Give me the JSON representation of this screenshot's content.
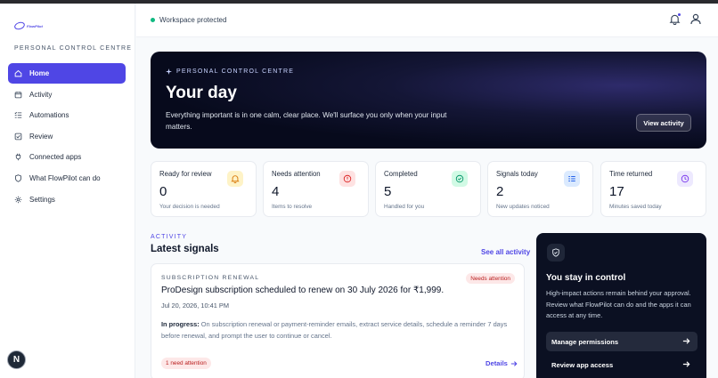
{
  "brand": {
    "logo_text": "FlowPilot",
    "accent": "#4f46e5"
  },
  "sidebar": {
    "heading": "PERSONAL CONTROL CENTRE",
    "items": [
      {
        "label": "Home",
        "icon": "home-icon",
        "active": true
      },
      {
        "label": "Activity",
        "icon": "calendar-icon"
      },
      {
        "label": "Automations",
        "icon": "list-check-icon"
      },
      {
        "label": "Review",
        "icon": "check-square-icon"
      },
      {
        "label": "Connected apps",
        "icon": "plug-icon"
      },
      {
        "label": "What FlowPilot can do",
        "icon": "shield-icon"
      },
      {
        "label": "Settings",
        "icon": "gear-icon"
      }
    ],
    "avatar_letter": "N"
  },
  "header": {
    "status_text": "Workspace protected",
    "status_color": "#10b981"
  },
  "hero": {
    "kicker": "PERSONAL CONTROL CENTRE",
    "title": "Your day",
    "description": "Everything important is in one calm, clear place. We'll surface you only when your input matters.",
    "button_label": "View activity"
  },
  "stats": [
    {
      "label": "Ready for review",
      "value": "0",
      "sub": "Your decision is needed",
      "icon": "bell-icon",
      "color": "#d97706",
      "bg": "#fef3c7"
    },
    {
      "label": "Needs attention",
      "value": "4",
      "sub": "Items to resolve",
      "icon": "alert-circle-icon",
      "color": "#dc2626",
      "bg": "#fee2e2"
    },
    {
      "label": "Completed",
      "value": "5",
      "sub": "Handled for you",
      "icon": "check-circle-icon",
      "color": "#059669",
      "bg": "#d1fae5"
    },
    {
      "label": "Signals today",
      "value": "2",
      "sub": "New updates noticed",
      "icon": "list-icon",
      "color": "#2563eb",
      "bg": "#dbeafe"
    },
    {
      "label": "Time returned",
      "value": "17",
      "sub": "Minutes saved today",
      "icon": "clock-icon",
      "color": "#7c3aed",
      "bg": "#ede9fe"
    }
  ],
  "activity": {
    "kicker": "ACTIVITY",
    "title": "Latest signals",
    "see_all": "See all activity"
  },
  "signal": {
    "kicker": "SUBSCRIPTION RENEWAL",
    "badge": "Needs attention",
    "title": "ProDesign subscription scheduled to renew on 30 July 2026 for ₹1,999.",
    "date": "Jul 20, 2026, 10:41 PM",
    "progress_label": "In progress:",
    "progress_text": "On subscription renewal or payment-reminder emails, extract service details, schedule a reminder 7 days before renewal, and prompt the user to continue or cancel.",
    "count_badge": "1 need attention",
    "details_label": "Details"
  },
  "control": {
    "title": "You stay in control",
    "description": "High-impact actions remain behind your approval. Review what FlowPilot can do and the apps it can access at any time.",
    "primary_button": "Manage permissions",
    "secondary_button": "Review app access"
  }
}
